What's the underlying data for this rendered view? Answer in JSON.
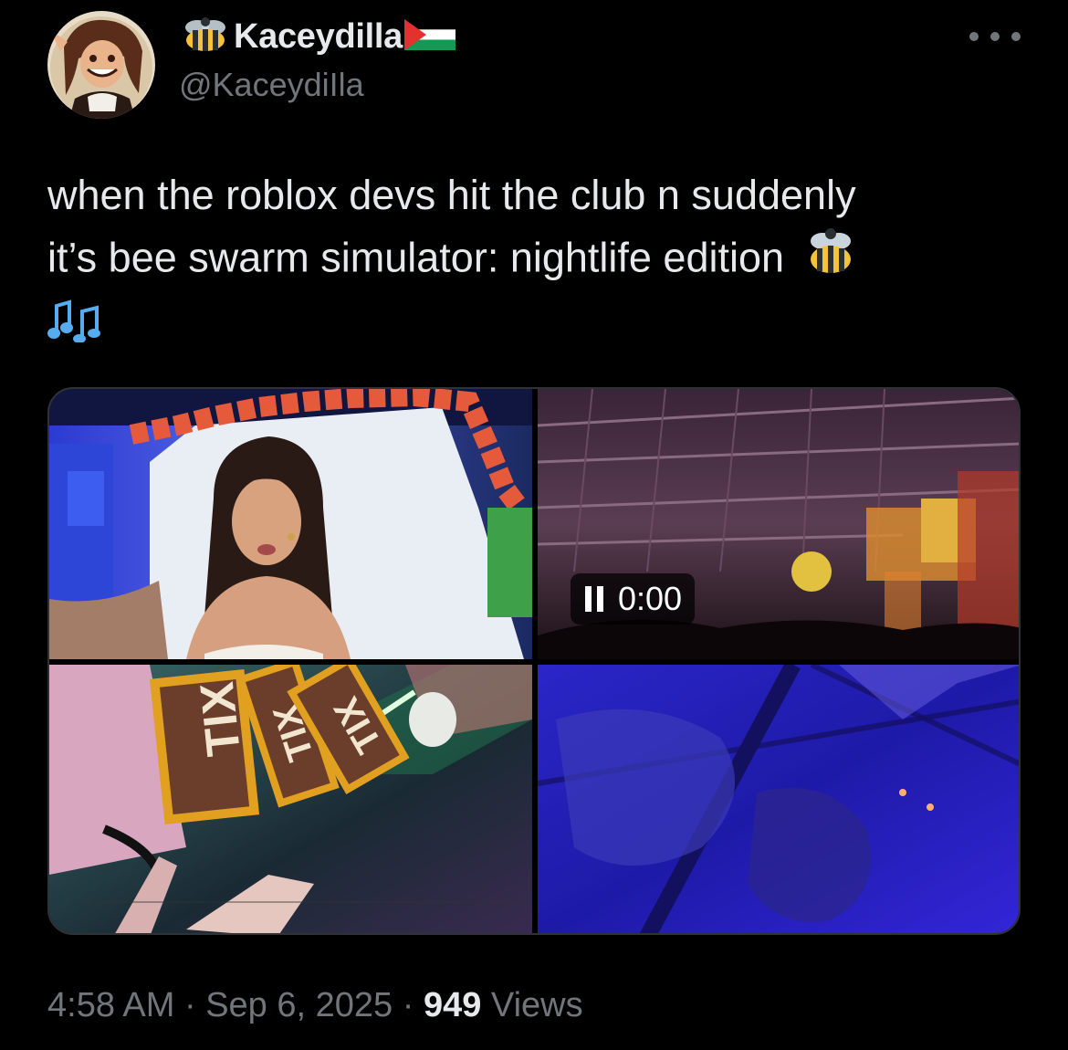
{
  "author": {
    "display_name": "Kaceydilla",
    "handle": "@KaceydiIla",
    "prefix_icon": "bee-emoji",
    "suffix_icon": "palestine-flag-emoji"
  },
  "tweet": {
    "line1": "when the roblox devs hit the club n suddenly",
    "line2": "it’s bee swarm simulator: nightlife edition",
    "trailing_icons": [
      "bee-emoji",
      "musical-notes-emoji"
    ]
  },
  "media": {
    "tiles": [
      "selfie-photo",
      "club-video",
      "tix-photo",
      "blue-floor-photo"
    ],
    "video_time": "0:00",
    "tix_text": [
      "TIX",
      "TIX",
      "TIX"
    ]
  },
  "meta": {
    "time": "4:58 AM",
    "separator": "·",
    "date": "Sep 6, 2025",
    "views_count": "949",
    "views_label": "Views"
  },
  "colors": {
    "background": "#000000",
    "text": "#e7e9ea",
    "secondary": "#71767b"
  }
}
